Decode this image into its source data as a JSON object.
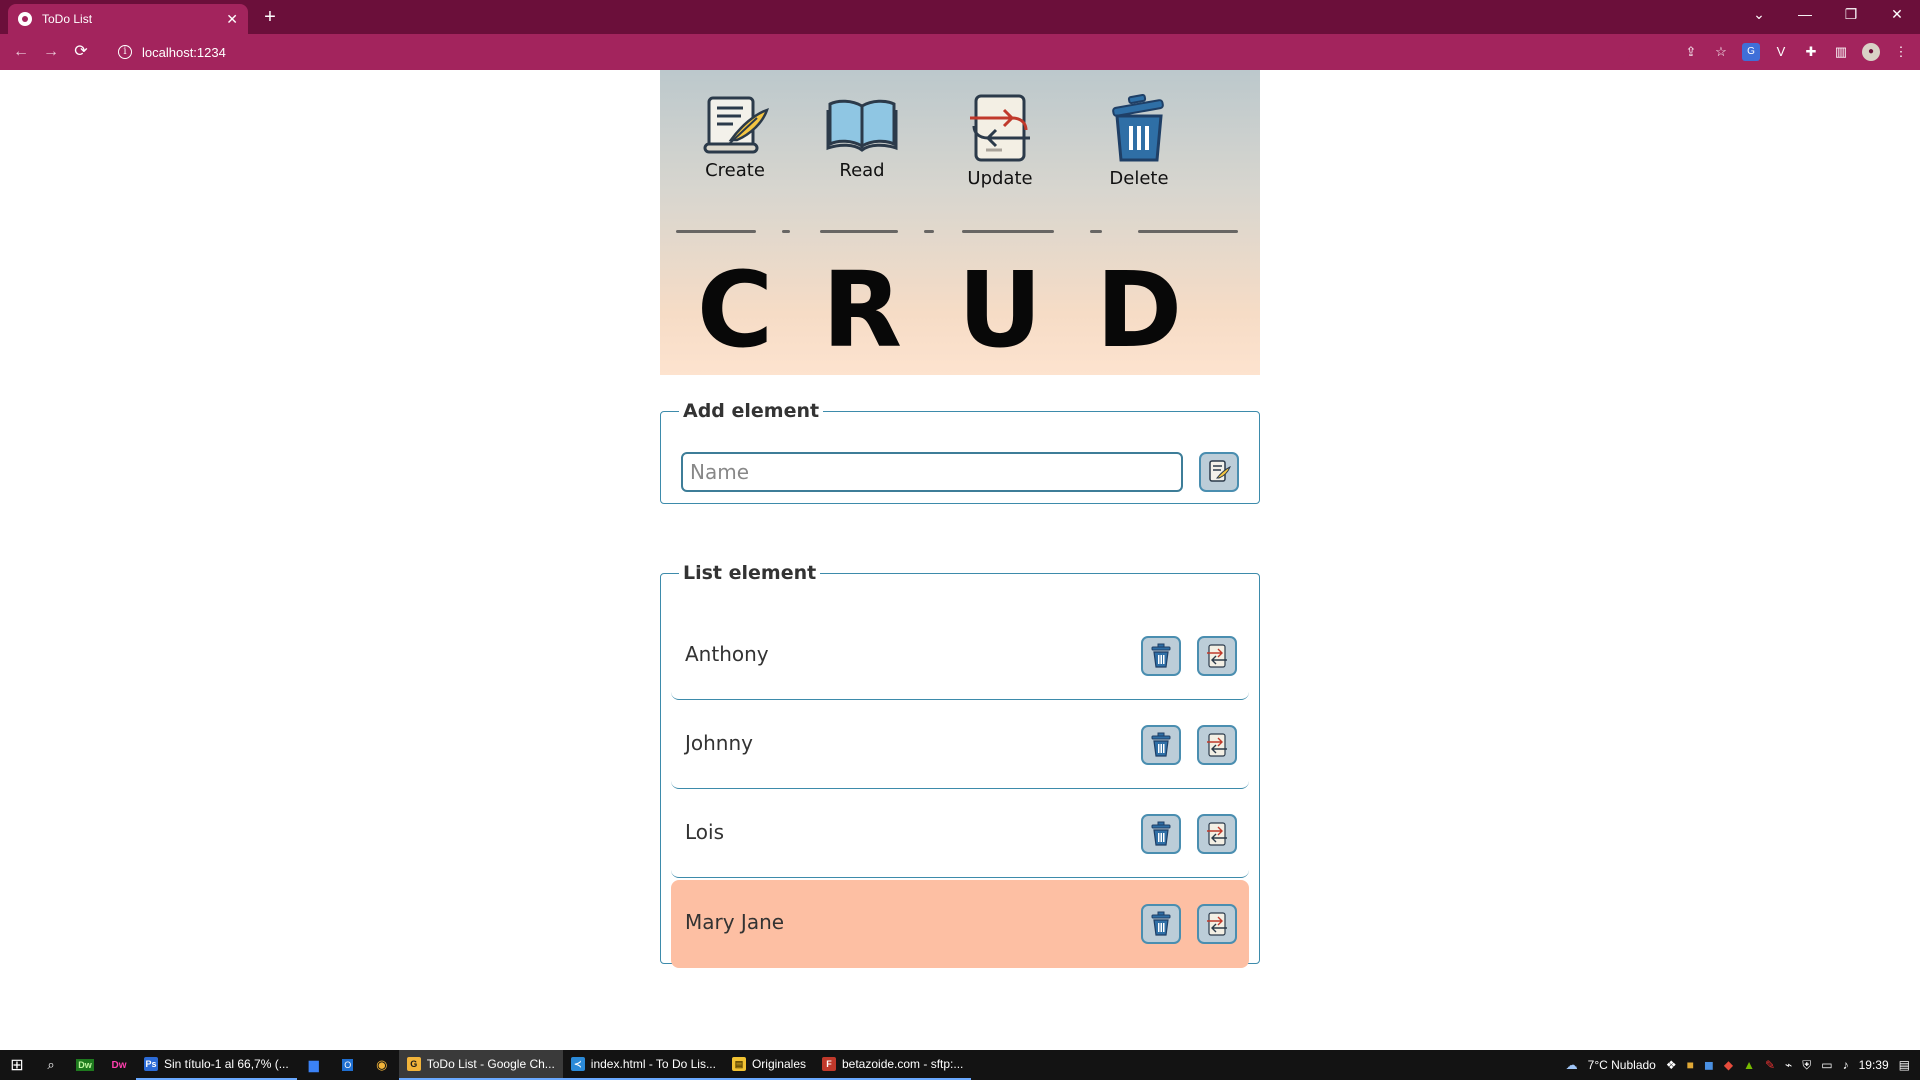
{
  "browser": {
    "tab_title": "ToDo List",
    "tab_close": "✕",
    "new_tab": "+",
    "url": "localhost:1234",
    "window_controls": {
      "minimize": "—",
      "restore": "❐",
      "close": "✕",
      "tab_search": "⌄"
    },
    "nav": {
      "back": "←",
      "forward": "→",
      "reload": "⟳"
    },
    "extensions": {
      "share": "⇪",
      "bookmark": "☆",
      "translate": "G",
      "vpn": "V",
      "puzzle": "✚",
      "sidepanel": "▥",
      "avatar": "●",
      "menu": "⋮"
    }
  },
  "hero": {
    "items": [
      {
        "label": "Create",
        "icon": "scroll-quill-icon"
      },
      {
        "label": "Read",
        "icon": "open-book-icon"
      },
      {
        "label": "Update",
        "icon": "update-document-icon"
      },
      {
        "label": "Delete",
        "icon": "trash-can-icon"
      }
    ],
    "letters": [
      "C",
      "R",
      "U",
      "D"
    ]
  },
  "add_panel": {
    "legend": "Add element",
    "input_value": "",
    "input_placeholder": "Name"
  },
  "list_panel": {
    "legend": "List element",
    "items": [
      {
        "name": "Anthony",
        "highlighted": false
      },
      {
        "name": "Johnny",
        "highlighted": false
      },
      {
        "name": "Lois",
        "highlighted": false
      },
      {
        "name": "Mary Jane",
        "highlighted": true
      }
    ]
  },
  "colors": {
    "browser_frame": "#6b0f3a",
    "browser_toolbar": "#a3245d",
    "panel_border": "#3d8bab",
    "highlight_row": "#fdbfa3",
    "button_fill": "#bccdd8"
  },
  "taskbar": {
    "apps": [
      {
        "label": "Sin título-1 al 66,7% (...",
        "icon": "Ps",
        "color": "#2c6bd6",
        "state": "open"
      },
      {
        "label": "ToDo List - Google Ch...",
        "icon": "G",
        "color": "#f2b43a",
        "state": "active"
      },
      {
        "label": "index.html - To Do Lis...",
        "icon": "≺",
        "color": "#2b8ad8",
        "state": "open"
      },
      {
        "label": "Originales",
        "icon": "▤",
        "color": "#f1c232",
        "state": "open"
      },
      {
        "label": "betazoide.com - sftp:...",
        "icon": "F",
        "color": "#c0392b",
        "state": "open"
      }
    ],
    "weather": "7°C  Nublado",
    "time": "19:39"
  }
}
